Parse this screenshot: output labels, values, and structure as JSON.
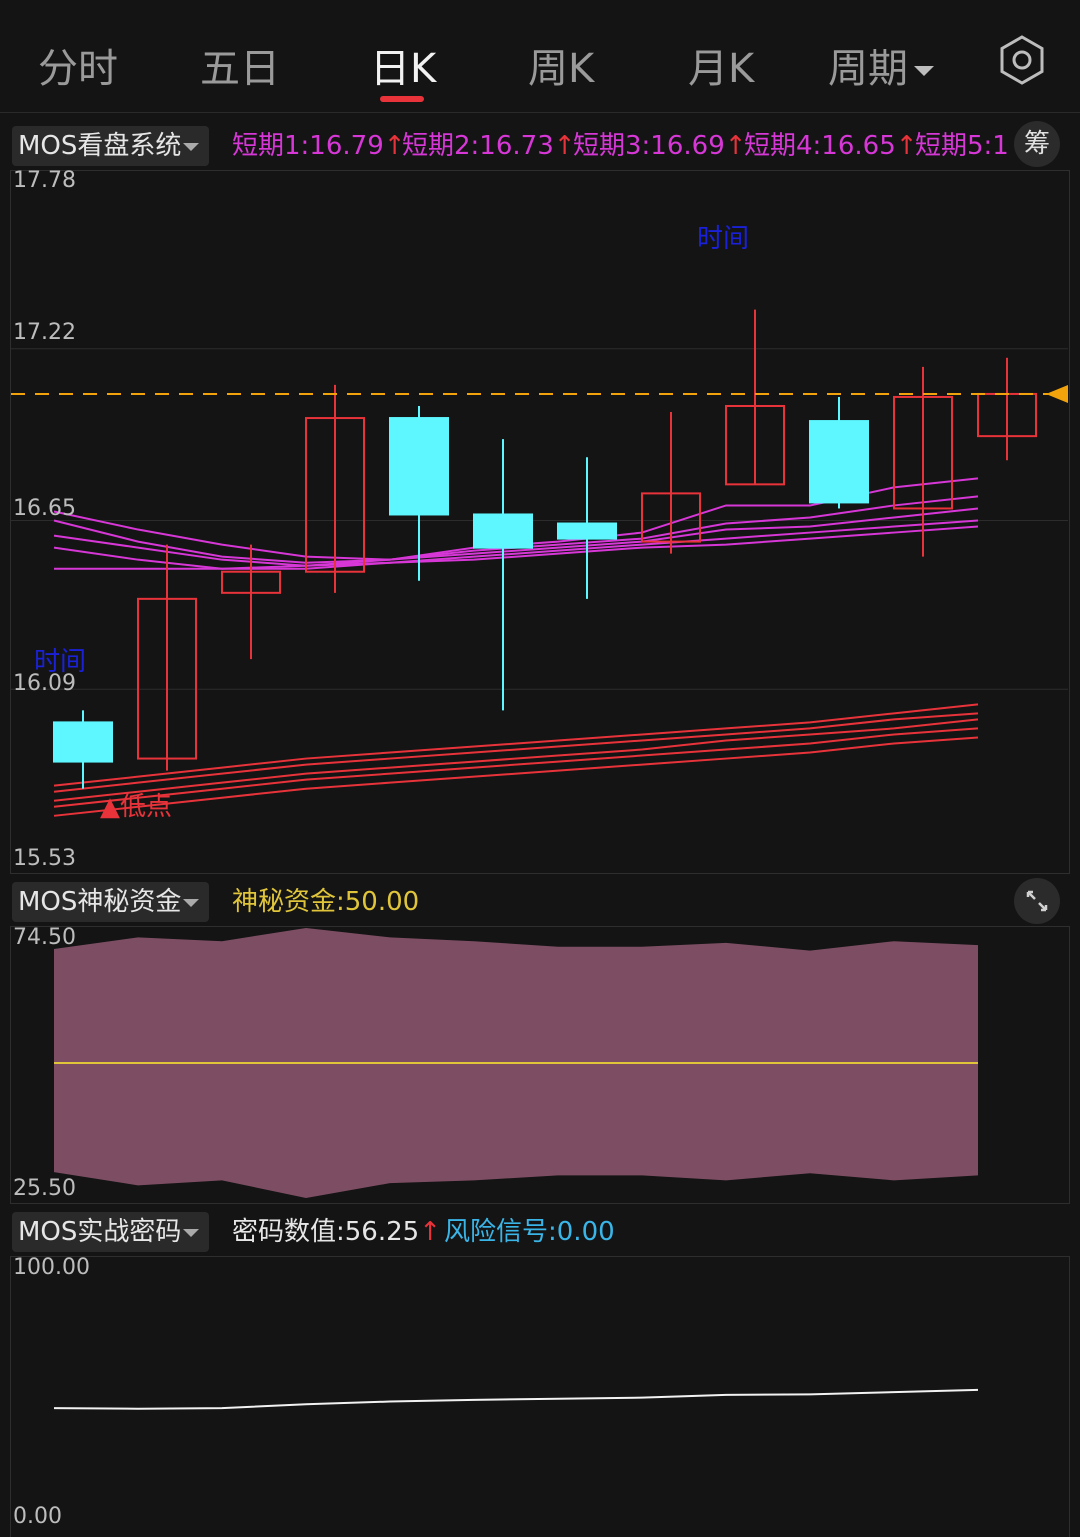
{
  "tabs": [
    "分时",
    "五日",
    "日K",
    "周K",
    "月K",
    "周期"
  ],
  "active_tab": "日K",
  "settings_icon": "hexagon-settings-icon",
  "colors": {
    "bg": "#141414",
    "rise": "#e8333a",
    "fall": "#5ef7ff",
    "ma_purple": "#d637d6",
    "yellow": "#e0c53a",
    "orange": "#f2a20a",
    "blue_label": "#1a21d9",
    "area": "#7d4e63",
    "cyan_text": "#3ab5e8"
  },
  "main_panel": {
    "selector": "MOS看盘系统",
    "indicators": [
      {
        "label": "短期1:16.79",
        "arrow": "↑"
      },
      {
        "label": "短期2:16.73",
        "arrow": "↑"
      },
      {
        "label": "短期3:16.69",
        "arrow": "↑"
      },
      {
        "label": "短期4:16.65",
        "arrow": "↑"
      },
      {
        "label": "短期5:1",
        "arrow": ""
      }
    ],
    "chip_button": "筹",
    "y_ticks": [
      "17.78",
      "17.22",
      "16.65",
      "16.09",
      "15.53"
    ],
    "annotations": {
      "time_top": "时间",
      "time_left": "时间",
      "low_point": "▲低点"
    },
    "current_price": 17.07
  },
  "chart_data": [
    {
      "type": "candlestick",
      "title": "",
      "ylim": [
        15.53,
        17.78
      ],
      "candles": [
        {
          "open": 15.98,
          "close": 15.85,
          "high": 16.02,
          "low": 15.76
        },
        {
          "open": 15.86,
          "close": 16.39,
          "high": 16.57,
          "low": 15.82
        },
        {
          "open": 16.41,
          "close": 16.48,
          "high": 16.57,
          "low": 16.19
        },
        {
          "open": 16.48,
          "close": 16.99,
          "high": 17.1,
          "low": 16.41
        },
        {
          "open": 16.99,
          "close": 16.67,
          "high": 17.03,
          "low": 16.45
        },
        {
          "open": 16.67,
          "close": 16.56,
          "high": 16.92,
          "low": 16.02
        },
        {
          "open": 16.64,
          "close": 16.59,
          "high": 16.86,
          "low": 16.39
        },
        {
          "open": 16.58,
          "close": 16.74,
          "high": 17.01,
          "low": 16.54
        },
        {
          "open": 16.77,
          "close": 17.03,
          "high": 17.35,
          "low": 16.77
        },
        {
          "open": 16.98,
          "close": 16.71,
          "high": 17.06,
          "low": 16.69
        },
        {
          "open": 16.69,
          "close": 17.06,
          "high": 17.16,
          "low": 16.53
        },
        {
          "open": 16.93,
          "close": 17.07,
          "high": 17.19,
          "low": 16.85
        }
      ],
      "ma_lines_purple": [
        [
          16.68,
          16.62,
          16.57,
          16.53,
          16.52,
          16.56,
          16.58,
          16.61,
          16.7,
          16.7,
          16.76,
          16.79
        ],
        [
          16.65,
          16.58,
          16.53,
          16.51,
          16.52,
          16.55,
          16.57,
          16.59,
          16.64,
          16.66,
          16.7,
          16.73
        ],
        [
          16.6,
          16.56,
          16.52,
          16.5,
          16.52,
          16.54,
          16.56,
          16.58,
          16.62,
          16.63,
          16.66,
          16.69
        ],
        [
          16.56,
          16.52,
          16.49,
          16.5,
          16.51,
          16.53,
          16.55,
          16.57,
          16.59,
          16.61,
          16.63,
          16.65
        ],
        [
          16.49,
          16.49,
          16.49,
          16.49,
          16.51,
          16.52,
          16.54,
          16.56,
          16.57,
          16.59,
          16.61,
          16.63
        ]
      ],
      "ma_lines_red": [
        [
          15.77,
          15.8,
          15.83,
          15.86,
          15.88,
          15.9,
          15.92,
          15.94,
          15.96,
          15.98,
          16.01,
          16.04
        ],
        [
          15.75,
          15.78,
          15.81,
          15.84,
          15.86,
          15.88,
          15.9,
          15.92,
          15.94,
          15.96,
          15.99,
          16.01
        ],
        [
          15.72,
          15.75,
          15.78,
          15.81,
          15.83,
          15.85,
          15.87,
          15.89,
          15.92,
          15.94,
          15.96,
          15.99
        ],
        [
          15.7,
          15.73,
          15.76,
          15.79,
          15.81,
          15.83,
          15.85,
          15.87,
          15.89,
          15.91,
          15.94,
          15.96
        ],
        [
          15.67,
          15.7,
          15.73,
          15.76,
          15.78,
          15.8,
          15.82,
          15.84,
          15.86,
          15.88,
          15.91,
          15.93
        ]
      ]
    },
    {
      "type": "area",
      "title": "",
      "ylim": [
        25.5,
        74.5
      ],
      "upper": [
        70.7,
        72.8,
        72.1,
        74.5,
        72.8,
        72.1,
        71.1,
        71.1,
        71.8,
        70.4,
        72.1,
        71.4
      ],
      "lower": [
        30.2,
        27.8,
        28.7,
        25.5,
        28.2,
        28.7,
        29.6,
        29.6,
        28.7,
        30.0,
        28.7,
        29.6
      ],
      "level": 50.0
    },
    {
      "type": "line",
      "title": "",
      "ylim": [
        0,
        100
      ],
      "values": [
        45.6,
        45.4,
        45.6,
        47.0,
        48.0,
        48.6,
        49.0,
        49.4,
        50.4,
        50.6,
        51.4,
        52.2
      ]
    }
  ],
  "fund_panel": {
    "selector": "MOS神秘资金",
    "indicator": "神秘资金:50.00",
    "y_ticks": [
      "74.50",
      "25.50"
    ],
    "expand_icon": "expand-arrows-icon"
  },
  "code_panel": {
    "selector": "MOS实战密码",
    "indicator1": "密码数值:56.25",
    "arrow1": "↑",
    "indicator2": "风险信号:0.00",
    "y_ticks": [
      "100.00",
      "0.00"
    ]
  }
}
